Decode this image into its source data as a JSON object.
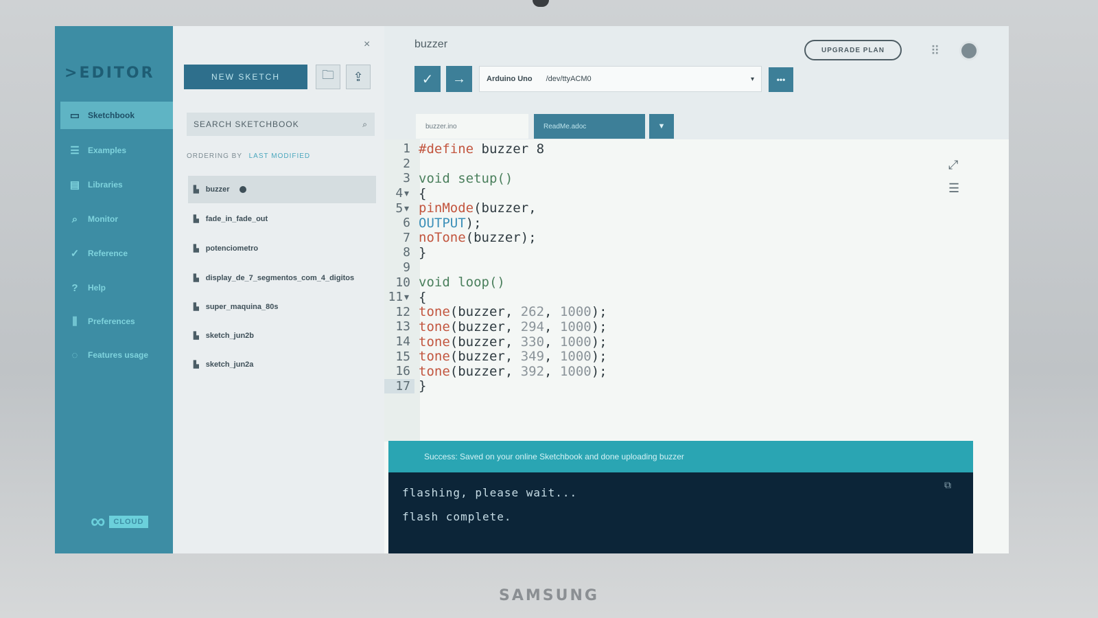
{
  "bezel": {
    "brand": "SAMSUNG"
  },
  "nav": {
    "logo": "EDITOR",
    "items": [
      {
        "label": "Sketchbook",
        "icon": "folder-icon"
      },
      {
        "label": "Examples",
        "icon": "list-icon"
      },
      {
        "label": "Libraries",
        "icon": "books-icon"
      },
      {
        "label": "Monitor",
        "icon": "search-icon"
      },
      {
        "label": "Reference",
        "icon": "check-circle-icon"
      },
      {
        "label": "Help",
        "icon": "help-icon"
      },
      {
        "label": "Preferences",
        "icon": "sliders-icon"
      },
      {
        "label": "Features usage",
        "icon": "cycle-icon"
      }
    ],
    "cloud_badge": "CLOUD"
  },
  "panel": {
    "close": "×",
    "new_sketch": "NEW SKETCH",
    "search_placeholder": "SEARCH SKETCHBOOK",
    "ordering_label": "ORDERING BY",
    "ordering_value": "LAST MODIFIED",
    "sketches": [
      "buzzer",
      "fade_in_fade_out",
      "potenciometro",
      "display_de_7_segmentos_com_4_digitos",
      "super_maquina_80s",
      "sketch_jun2b",
      "sketch_jun2a"
    ]
  },
  "toolbar": {
    "sketch_name": "buzzer",
    "upgrade": "UPGRADE PLAN",
    "board": "Arduino Uno",
    "port": "/dev/ttyACM0",
    "more": "•••"
  },
  "tabs": {
    "file1": "buzzer.ino",
    "file2": "ReadMe.adoc"
  },
  "code_lines": [
    "#define buzzer 8",
    "",
    "void setup()",
    "{",
    "pinMode(buzzer,",
    "OUTPUT);",
    "noTone(buzzer);",
    "}",
    "",
    "void loop()",
    "{",
    "tone(buzzer, 262, 1000);",
    "tone(buzzer, 294, 1000);",
    "tone(buzzer, 330, 1000);",
    "tone(buzzer, 349, 1000);",
    "tone(buzzer, 392, 1000);",
    "}"
  ],
  "status": "Success: Saved on your online Sketchbook and done uploading buzzer",
  "console": [
    "flashing, please wait...",
    "flash complete."
  ]
}
